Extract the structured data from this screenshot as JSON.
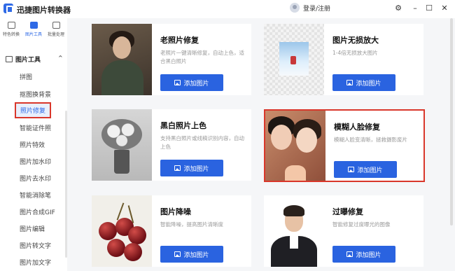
{
  "app": {
    "title": "迅捷图片转换器",
    "login_text": "登录/注册",
    "window_controls": [
      "settings-icon",
      "minimize-icon",
      "maximize-icon",
      "close-icon"
    ]
  },
  "modes": [
    {
      "label": "特色转换",
      "icon": "convert-icon",
      "active": false
    },
    {
      "label": "图片工具",
      "icon": "tools-icon",
      "active": true
    },
    {
      "label": "批量处理",
      "icon": "batch-icon",
      "active": false
    }
  ],
  "sidebar": {
    "section_label": "图片工具",
    "items": [
      {
        "label": "拼图",
        "selected": false
      },
      {
        "label": "抠图换背景",
        "selected": false
      },
      {
        "label": "照片修复",
        "selected": true
      },
      {
        "label": "智能证件照",
        "selected": false
      },
      {
        "label": "照片特效",
        "selected": false
      },
      {
        "label": "图片加水印",
        "selected": false
      },
      {
        "label": "图片去水印",
        "selected": false
      },
      {
        "label": "智能消除笔",
        "selected": false
      },
      {
        "label": "图片合成GIF",
        "selected": false
      },
      {
        "label": "图片编辑",
        "selected": false
      },
      {
        "label": "图片转文字",
        "selected": false
      },
      {
        "label": "图片加文字",
        "selected": false
      }
    ]
  },
  "cards": [
    {
      "title": "老照片修复",
      "desc": "老照片一键清晰修复，自动上色，适合黑白照片",
      "button": "添加图片",
      "highlighted": false
    },
    {
      "title": "图片无损放大",
      "desc": "1-4倍无损放大图片",
      "button": "添加图片",
      "highlighted": false
    },
    {
      "title": "黑白照片上色",
      "desc": "支持黑白照片或线稿识别内容，自动上色",
      "button": "添加图片",
      "highlighted": false
    },
    {
      "title": "模糊人脸修复",
      "desc": "模糊人脸变清晰，拯救摄影废片",
      "button": "添加图片",
      "highlighted": true
    },
    {
      "title": "图片降噪",
      "desc": "智能降噪，提高图片清晰度",
      "button": "添加图片",
      "highlighted": false
    },
    {
      "title": "过曝修复",
      "desc": "智能修复过度曝光的图像",
      "button": "添加图片",
      "highlighted": false
    }
  ],
  "colors": {
    "accent": "#2a63e0",
    "highlight_border": "#d9372b",
    "main_bg": "#f5f6f8"
  }
}
